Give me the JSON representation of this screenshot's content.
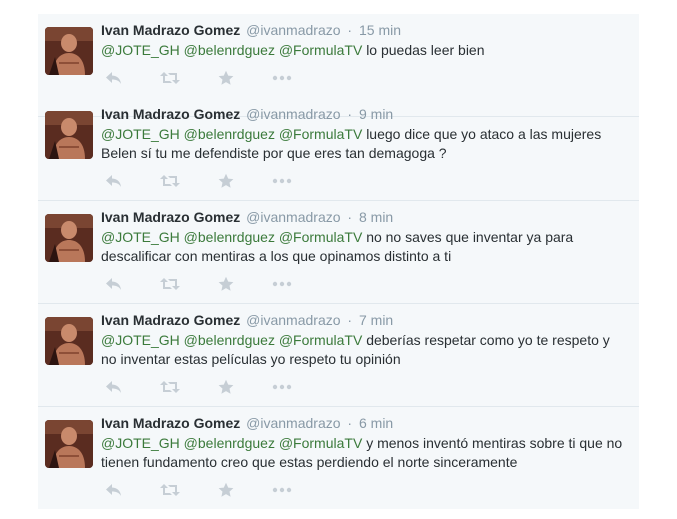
{
  "tweets": [
    {
      "fullname": "Ivan Madrazo Gomez",
      "username": "@ivanmadrazo",
      "time": "15 min",
      "mentions": [
        "@JOTE_GH",
        "@belenrdguez",
        "@FormulaTV"
      ],
      "text": "lo puedas leer bien"
    },
    {
      "fullname": "Ivan Madrazo Gomez",
      "username": "@ivanmadrazo",
      "time": "9 min",
      "mentions": [
        "@JOTE_GH",
        "@belenrdguez",
        "@FormulaTV"
      ],
      "text": "luego dice que yo ataco a las mujeres Belen sí tu me defendiste por que eres tan demagoga ?"
    },
    {
      "fullname": "Ivan Madrazo Gomez",
      "username": "@ivanmadrazo",
      "time": "8 min",
      "mentions": [
        "@JOTE_GH",
        "@belenrdguez",
        "@FormulaTV"
      ],
      "text": "no no saves que inventar ya para descalificar con mentiras a los que opinamos distinto a ti"
    },
    {
      "fullname": "Ivan Madrazo Gomez",
      "username": "@ivanmadrazo",
      "time": "7 min",
      "mentions": [
        "@JOTE_GH",
        "@belenrdguez",
        "@FormulaTV"
      ],
      "text": "deberías respetar como yo te respeto y no inventar estas películas yo respeto tu opinión"
    },
    {
      "fullname": "Ivan Madrazo Gomez",
      "username": "@ivanmadrazo",
      "time": "6 min",
      "mentions": [
        "@JOTE_GH",
        "@belenrdguez",
        "@FormulaTV"
      ],
      "text": "y menos inventó  mentiras sobre ti que no tienen fundamento creo que estas perdiendo el norte sinceramente"
    }
  ],
  "separator": "·",
  "colors": {
    "mention": "#3b7a3b",
    "meta": "#8899a6",
    "icon": "#c6ced5",
    "background": "#f5f8fa",
    "divider": "#e1e8ed"
  },
  "icons": [
    "reply-icon",
    "retweet-icon",
    "favorite-icon",
    "more-icon"
  ]
}
